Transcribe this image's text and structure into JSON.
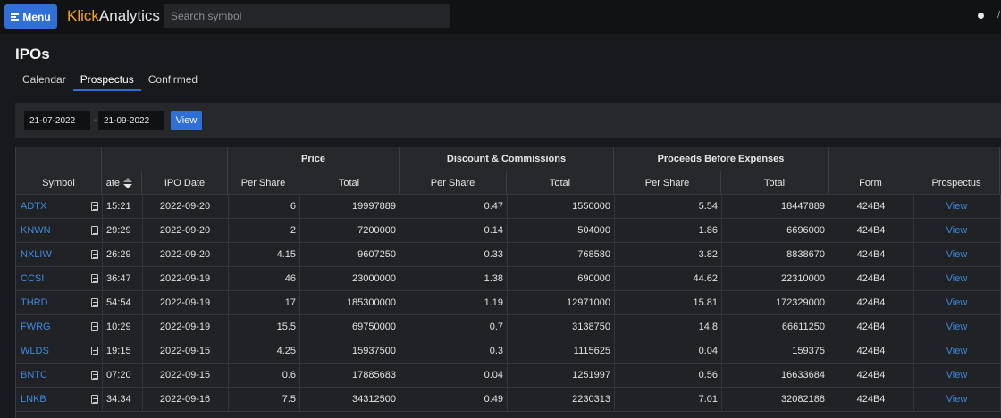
{
  "topbar": {
    "menu_label": "Menu",
    "logo_klick": "Klick",
    "logo_analytics": "Analytics",
    "search_placeholder": "Search symbol"
  },
  "page": {
    "title": "IPOs",
    "tabs": [
      {
        "label": "Calendar",
        "active": false
      },
      {
        "label": "Prospectus",
        "active": true
      },
      {
        "label": "Confirmed",
        "active": false
      }
    ]
  },
  "filter": {
    "from_date": "21-07-2022",
    "separator": "-",
    "to_date": "21-09-2022",
    "view_label": "View"
  },
  "table": {
    "group_headers": {
      "price": "Price",
      "discount": "Discount & Commissions",
      "proceeds": "Proceeds Before Expenses"
    },
    "columns": {
      "symbol": "Symbol",
      "date": "ate",
      "ipo_date": "IPO Date",
      "price_per_share": "Per Share",
      "price_total": "Total",
      "discount_per_share": "Per Share",
      "discount_total": "Total",
      "proceeds_per_share": "Per Share",
      "proceeds_total": "Total",
      "form": "Form",
      "prospectus": "Prospectus"
    },
    "rows": [
      {
        "symbol": "ADTX",
        "time": ":15:21",
        "ipo_date": "2022-09-20",
        "price_per_share": "6",
        "price_total": "19997889",
        "disc_per_share": "0.47",
        "disc_total": "1550000",
        "proc_per_share": "5.54",
        "proc_total": "18447889",
        "form": "424B4",
        "link": "View"
      },
      {
        "symbol": "KNWN",
        "time": ":29:29",
        "ipo_date": "2022-09-20",
        "price_per_share": "2",
        "price_total": "7200000",
        "disc_per_share": "0.14",
        "disc_total": "504000",
        "proc_per_share": "1.86",
        "proc_total": "6696000",
        "form": "424B4",
        "link": "View"
      },
      {
        "symbol": "NXLIW",
        "time": ":26:29",
        "ipo_date": "2022-09-20",
        "price_per_share": "4.15",
        "price_total": "9607250",
        "disc_per_share": "0.33",
        "disc_total": "768580",
        "proc_per_share": "3.82",
        "proc_total": "8838670",
        "form": "424B4",
        "link": "View"
      },
      {
        "symbol": "CCSI",
        "time": ":36:47",
        "ipo_date": "2022-09-19",
        "price_per_share": "46",
        "price_total": "23000000",
        "disc_per_share": "1.38",
        "disc_total": "690000",
        "proc_per_share": "44.62",
        "proc_total": "22310000",
        "form": "424B4",
        "link": "View"
      },
      {
        "symbol": "THRD",
        "time": ":54:54",
        "ipo_date": "2022-09-19",
        "price_per_share": "17",
        "price_total": "185300000",
        "disc_per_share": "1.19",
        "disc_total": "12971000",
        "proc_per_share": "15.81",
        "proc_total": "172329000",
        "form": "424B4",
        "link": "View"
      },
      {
        "symbol": "FWRG",
        "time": ":10:29",
        "ipo_date": "2022-09-19",
        "price_per_share": "15.5",
        "price_total": "69750000",
        "disc_per_share": "0.7",
        "disc_total": "3138750",
        "proc_per_share": "14.8",
        "proc_total": "66611250",
        "form": "424B4",
        "link": "View"
      },
      {
        "symbol": "WLDS",
        "time": ":19:15",
        "ipo_date": "2022-09-15",
        "price_per_share": "4.25",
        "price_total": "15937500",
        "disc_per_share": "0.3",
        "disc_total": "1115625",
        "proc_per_share": "0.04",
        "proc_total": "159375",
        "form": "424B4",
        "link": "View"
      },
      {
        "symbol": "BNTC",
        "time": ":07:20",
        "ipo_date": "2022-09-15",
        "price_per_share": "0.6",
        "price_total": "17885683",
        "disc_per_share": "0.04",
        "disc_total": "1251997",
        "proc_per_share": "0.56",
        "proc_total": "16633684",
        "form": "424B4",
        "link": "View"
      },
      {
        "symbol": "LNKB",
        "time": ":34:34",
        "ipo_date": "2022-09-16",
        "price_per_share": "7.5",
        "price_total": "34312500",
        "disc_per_share": "0.49",
        "disc_total": "2230313",
        "proc_per_share": "7.01",
        "proc_total": "32082188",
        "form": "424B4",
        "link": "View"
      }
    ]
  }
}
